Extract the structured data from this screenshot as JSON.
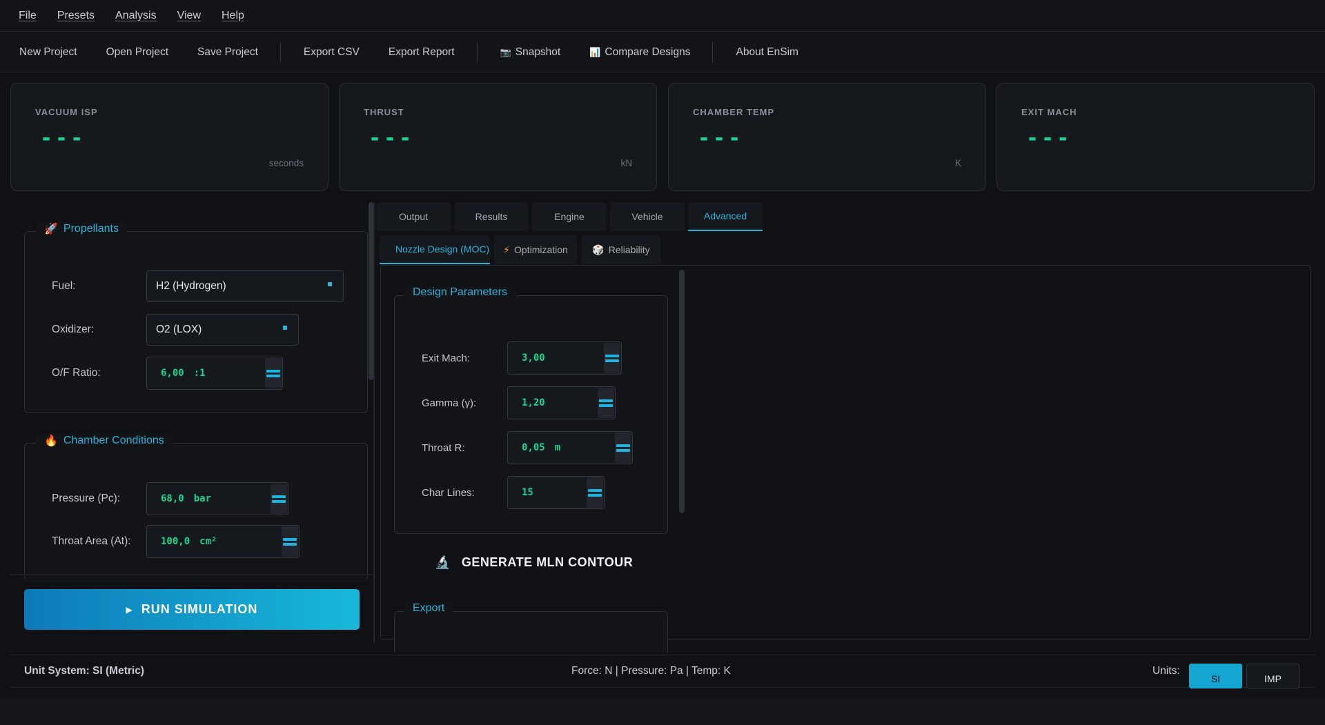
{
  "menu": [
    "File",
    "Presets",
    "Analysis",
    "View",
    "Help"
  ],
  "toolbar": {
    "new_project": "New Project",
    "open_project": "Open Project",
    "save_project": "Save Project",
    "export_csv": "Export CSV",
    "export_report": "Export Report",
    "snapshot": "Snapshot",
    "compare_designs": "Compare Designs",
    "about": "About EnSim"
  },
  "stats": [
    {
      "label": "VACUUM ISP",
      "value": "---",
      "unit": "seconds"
    },
    {
      "label": "THRUST",
      "value": "---",
      "unit": "kN"
    },
    {
      "label": "CHAMBER TEMP",
      "value": "---",
      "unit": "K"
    },
    {
      "label": "EXIT MACH",
      "value": "---",
      "unit": ""
    }
  ],
  "propellants": {
    "title": "Propellants",
    "icon": "rocket-icon",
    "fuel_label": "Fuel:",
    "fuel_value": "H2 (Hydrogen)",
    "oxidizer_label": "Oxidizer:",
    "oxidizer_value": "O2 (LOX)",
    "of_label": "O/F Ratio:",
    "of_value": "6,00",
    "of_unit": ":1"
  },
  "chamber": {
    "title": "Chamber Conditions",
    "icon": "fire-icon",
    "pressure_label": "Pressure (Pc):",
    "pressure_value": "68,0",
    "pressure_unit": "bar",
    "throat_label": "Throat Area (At):",
    "throat_value": "100,0",
    "throat_unit": "cm²"
  },
  "run_button": "RUN SIMULATION",
  "tabs": [
    "Output",
    "Results",
    "Engine",
    "Vehicle",
    "Advanced"
  ],
  "active_tab": "Advanced",
  "subtabs": {
    "nozzle": "Nozzle Design (MOC)",
    "optimization": "Optimization",
    "reliability": "Reliability"
  },
  "design": {
    "title": "Design Parameters",
    "exit_mach_label": "Exit Mach:",
    "exit_mach_value": "3,00",
    "gamma_label": "Gamma (γ):",
    "gamma_value": "1,20",
    "throat_r_label": "Throat R:",
    "throat_r_value": "0,05",
    "throat_r_unit": "m",
    "char_lines_label": "Char Lines:",
    "char_lines_value": "15"
  },
  "generate_button": "GENERATE MLN CONTOUR",
  "export_title": "Export",
  "status": {
    "unit_system": "Unit System: SI (Metric)",
    "units_info": "Force: N | Pressure: Pa | Temp: K",
    "units_label": "Units:",
    "si": "SI",
    "imp": "IMP"
  },
  "colors": {
    "accent": "#2bb3d9",
    "value_green": "#17d68f",
    "background": "#0f1115"
  }
}
